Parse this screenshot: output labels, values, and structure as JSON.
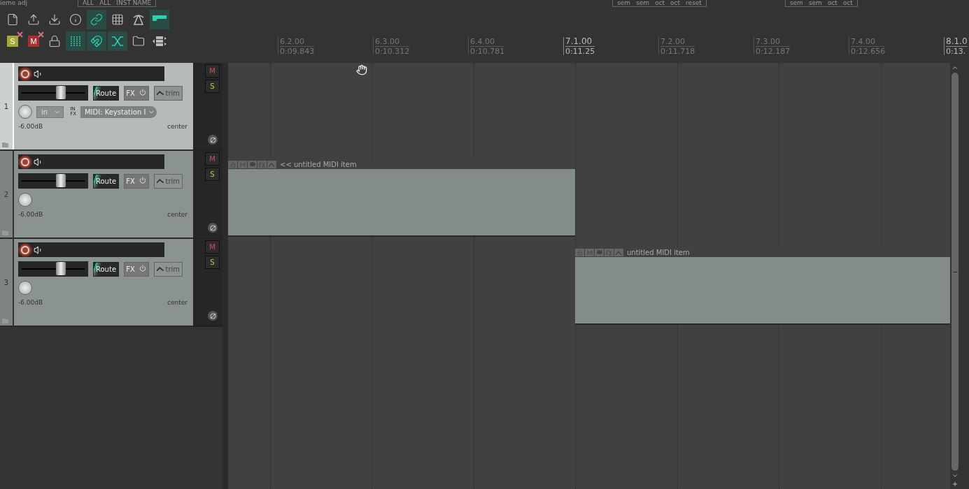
{
  "top_strip": {
    "left_text": "ieme adj",
    "filter_buttons": [
      "ALL",
      "ALL",
      "INST NAME"
    ],
    "pitch_buttons": [
      "sem",
      "sem",
      "oct",
      "oct",
      "reset"
    ],
    "pitch_buttons_2": [
      "sem",
      "sem",
      "oct",
      "oct"
    ]
  },
  "toolbar": {
    "rows": [
      [
        {
          "kind": "file",
          "on": false
        },
        {
          "kind": "upload",
          "on": false
        },
        {
          "kind": "download",
          "on": false
        },
        {
          "kind": "info",
          "on": false
        },
        {
          "kind": "link",
          "on": true
        },
        {
          "kind": "grid",
          "on": false
        },
        {
          "kind": "road",
          "on": false
        },
        {
          "kind": "panel",
          "on": true
        }
      ],
      [
        {
          "kind": "solo-clear",
          "label": "S",
          "on": false
        },
        {
          "kind": "mute-clear",
          "label": "M",
          "on": false
        },
        {
          "kind": "lock",
          "on": false
        },
        {
          "kind": "snap",
          "on": true
        },
        {
          "kind": "magnet",
          "on": true
        },
        {
          "kind": "crossfade",
          "on": true
        },
        {
          "kind": "folder",
          "on": false
        },
        {
          "kind": "layout",
          "on": false
        }
      ]
    ]
  },
  "ruler": {
    "markers": [
      {
        "bar": "6.2.00",
        "time": "0:09.843",
        "major": false
      },
      {
        "bar": "6.3.00",
        "time": "0:10.312",
        "major": false
      },
      {
        "bar": "6.4.00",
        "time": "0:10.781",
        "major": false
      },
      {
        "bar": "7.1.00",
        "time": "0:11.25",
        "major": true
      },
      {
        "bar": "7.2.00",
        "time": "0:11.718",
        "major": false
      },
      {
        "bar": "7.3.00",
        "time": "0:12.187",
        "major": false
      },
      {
        "bar": "7.4.00",
        "time": "0:12.656",
        "major": false
      },
      {
        "bar": "8.1.0",
        "time": "0:13.",
        "major": true
      }
    ]
  },
  "tracks": [
    {
      "number": "1",
      "selected": true,
      "level": 0.62,
      "route": "Route",
      "fx": "FX",
      "trim": "trim",
      "input": "in",
      "input_device": "MIDI: Keystation I",
      "input_tag_1": "IN",
      "input_tag_2": "FX",
      "volume": "-6.00dB",
      "pan": "center",
      "mute": "M",
      "solo": "S"
    },
    {
      "number": "2",
      "selected": false,
      "level": 0.62,
      "route": "Route",
      "fx": "FX",
      "trim": "trim",
      "volume": "-6.00dB",
      "pan": "center",
      "mute": "M",
      "solo": "S",
      "items": [
        {
          "title": "<< untitled MIDI item",
          "kind": "left"
        }
      ]
    },
    {
      "number": "3",
      "selected": false,
      "level": 0.62,
      "route": "Route",
      "fx": "FX",
      "trim": "trim",
      "volume": "-6.00dB",
      "pan": "center",
      "mute": "M",
      "solo": "S",
      "items": [
        {
          "title": "untitled MIDI item",
          "kind": "right"
        }
      ]
    }
  ]
}
